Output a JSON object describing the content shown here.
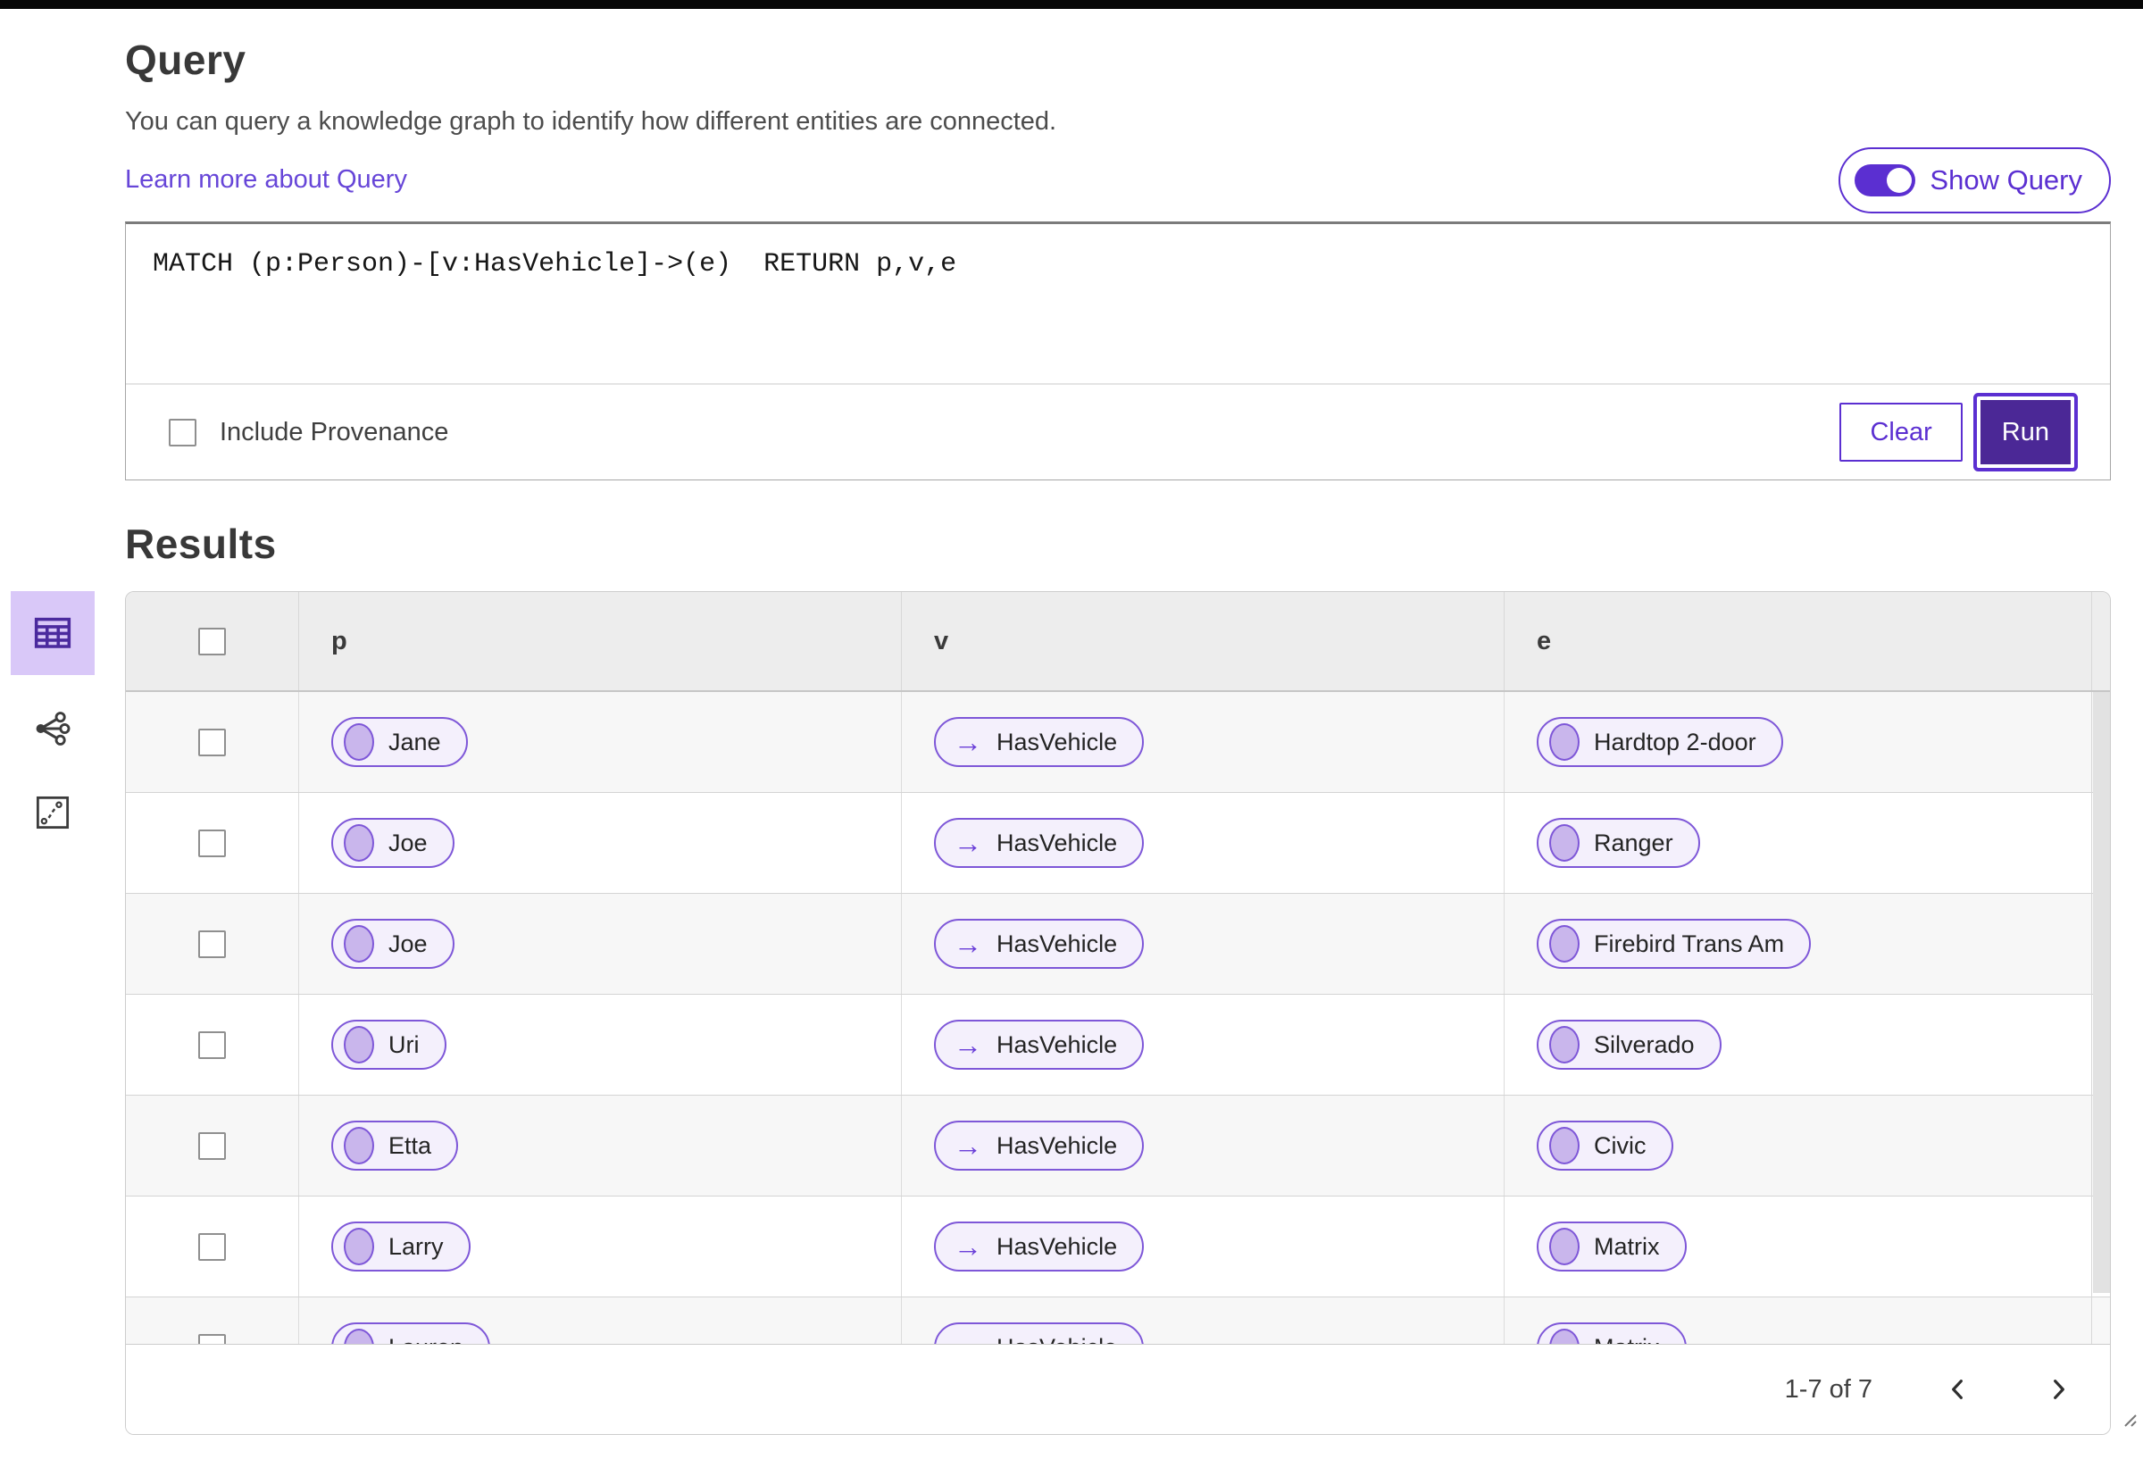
{
  "query_section": {
    "title": "Query",
    "description": "You can query a knowledge graph to identify how different entities are connected.",
    "learn_more_label": "Learn more about Query",
    "show_query_label": "Show Query",
    "show_query_on": true,
    "query_text": "MATCH (p:Person)-[v:HasVehicle]->(e)  RETURN p,v,e",
    "include_provenance_label": "Include Provenance",
    "include_provenance_checked": false,
    "clear_label": "Clear",
    "run_label": "Run"
  },
  "results_section": {
    "title": "Results",
    "columns": [
      "p",
      "v",
      "e"
    ],
    "rows": [
      {
        "p": "Jane",
        "v": "HasVehicle",
        "e": "Hardtop 2-door"
      },
      {
        "p": "Joe",
        "v": "HasVehicle",
        "e": "Ranger"
      },
      {
        "p": "Joe",
        "v": "HasVehicle",
        "e": "Firebird Trans Am"
      },
      {
        "p": "Uri",
        "v": "HasVehicle",
        "e": "Silverado"
      },
      {
        "p": "Etta",
        "v": "HasVehicle",
        "e": "Civic"
      },
      {
        "p": "Larry",
        "v": "HasVehicle",
        "e": "Matrix"
      },
      {
        "p": "Lauren",
        "v": "HasVehicle",
        "e": "Matrix"
      }
    ],
    "pagination": {
      "range_label": "1-7 of 7"
    }
  },
  "icons": {
    "edge_arrow": "→"
  },
  "colors": {
    "accent_purple": "#5b2fd1",
    "run_button_fill": "#4b2896",
    "pill_border": "#7e57d8",
    "pill_background": "#f4f0fc",
    "node_dot_fill": "#c9b6ec",
    "link_purple": "#6746d8",
    "selected_view_background": "#d9c8f8",
    "table_header_background": "#ededed",
    "striped_row_background": "#f7f7f7"
  }
}
